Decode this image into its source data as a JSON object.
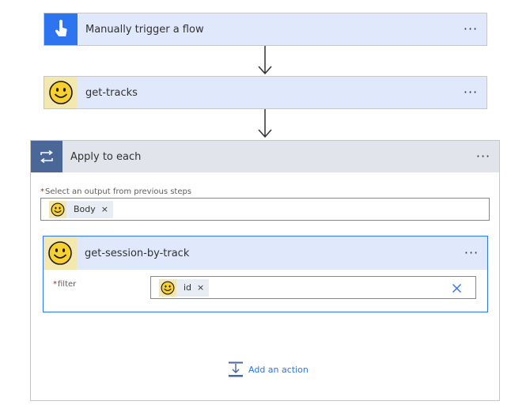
{
  "trigger": {
    "title": "Manually trigger a flow",
    "icon": "touch-hand-icon",
    "accent": "#2c74f0"
  },
  "get_tracks": {
    "title": "get-tracks",
    "icon": "smiley-icon"
  },
  "apply_to_each": {
    "title": "Apply to each",
    "icon": "loop-icon",
    "accent": "#4a6797",
    "output_label": "Select an output from previous steps",
    "output_token": {
      "label": "Body",
      "remove": "×"
    },
    "inner_action": {
      "title": "get-session-by-track",
      "filter_label": "filter",
      "filter_token": {
        "label": "id",
        "remove": "×"
      }
    },
    "add_action_label": "Add an action"
  },
  "more_menu": "···",
  "required_marker": "*"
}
